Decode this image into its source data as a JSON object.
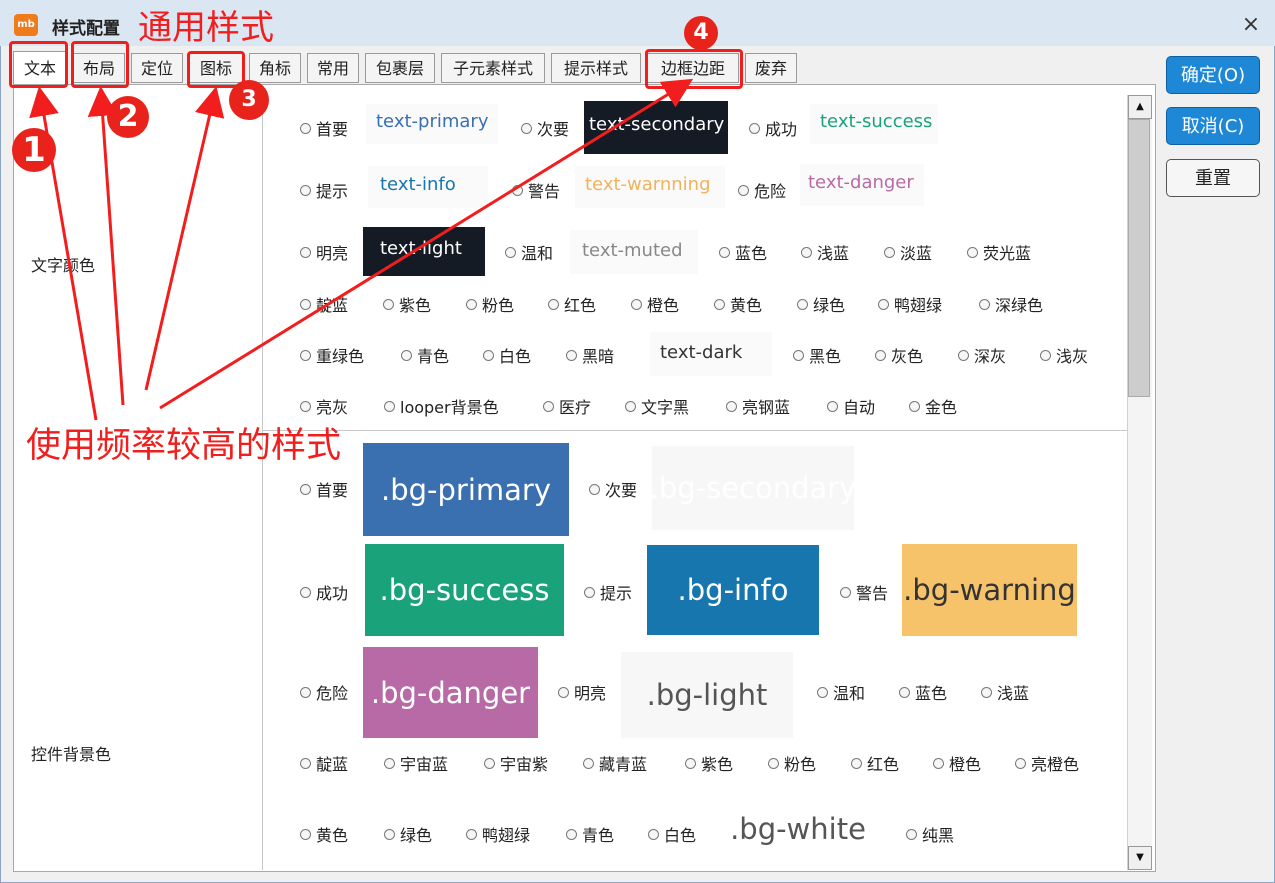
{
  "window": {
    "title": "样式配置",
    "app_icon_text": "mb",
    "close_glyph": "×"
  },
  "tabs": [
    "文本",
    "布局",
    "定位",
    "图标",
    "角标",
    "常用",
    "包裹层",
    "子元素样式",
    "提示样式",
    "边框边距",
    "废弃"
  ],
  "active_tab": "文本",
  "buttons": {
    "ok": "确定(O)",
    "cancel": "取消(C)",
    "reset": "重置"
  },
  "text_color": {
    "group_label": "文字颜色",
    "rows": [
      [
        {
          "label": "首要",
          "sample": "text-primary"
        },
        {
          "label": "次要",
          "sample": "text-secondary"
        },
        {
          "label": "成功",
          "sample": "text-success"
        }
      ],
      [
        {
          "label": "提示",
          "sample": "text-info"
        },
        {
          "label": "警告",
          "sample": "text-warnning"
        },
        {
          "label": "危险",
          "sample": "text-danger"
        }
      ],
      [
        {
          "label": "明亮",
          "sample": "text-light"
        },
        {
          "label": "温和",
          "sample": "text-muted"
        },
        {
          "label": "蓝色"
        },
        {
          "label": "浅蓝"
        },
        {
          "label": "淡蓝"
        },
        {
          "label": "荧光蓝"
        }
      ],
      [
        {
          "label": "靛蓝"
        },
        {
          "label": "紫色"
        },
        {
          "label": "粉色"
        },
        {
          "label": "红色"
        },
        {
          "label": "橙色"
        },
        {
          "label": "黄色"
        },
        {
          "label": "绿色"
        },
        {
          "label": "鸭翅绿"
        },
        {
          "label": "深绿色"
        }
      ],
      [
        {
          "label": "重绿色"
        },
        {
          "label": "青色"
        },
        {
          "label": "白色"
        },
        {
          "label": "黑暗",
          "sample": "text-dark"
        },
        {
          "label": "黑色"
        },
        {
          "label": "灰色"
        },
        {
          "label": "深灰"
        },
        {
          "label": "浅灰"
        }
      ],
      [
        {
          "label": "亮灰"
        },
        {
          "label": "looper背景色"
        },
        {
          "label": "医疗"
        },
        {
          "label": "文字黑"
        },
        {
          "label": "亮钢蓝"
        },
        {
          "label": "自动"
        },
        {
          "label": "金色"
        }
      ]
    ]
  },
  "bg_color": {
    "group_label": "控件背景色",
    "rows": [
      [
        {
          "label": "首要",
          "sample": ".bg-primary"
        },
        {
          "label": "次要",
          "sample": ".bg-secondary"
        }
      ],
      [
        {
          "label": "成功",
          "sample": ".bg-success"
        },
        {
          "label": "提示",
          "sample": ".bg-info"
        },
        {
          "label": "警告",
          "sample": ".bg-warning"
        }
      ],
      [
        {
          "label": "危险",
          "sample": ".bg-danger"
        },
        {
          "label": "明亮",
          "sample": ".bg-light"
        },
        {
          "label": "温和"
        },
        {
          "label": "蓝色"
        },
        {
          "label": "浅蓝"
        }
      ],
      [
        {
          "label": "靛蓝"
        },
        {
          "label": "宇宙蓝"
        },
        {
          "label": "宇宙紫"
        },
        {
          "label": "藏青蓝"
        },
        {
          "label": "紫色"
        },
        {
          "label": "粉色"
        },
        {
          "label": "红色"
        },
        {
          "label": "橙色"
        },
        {
          "label": "亮橙色"
        }
      ],
      [
        {
          "label": "黄色"
        },
        {
          "label": "绿色"
        },
        {
          "label": "鸭翅绿"
        },
        {
          "label": "青色"
        },
        {
          "label": "白色",
          "sample": ".bg-white"
        },
        {
          "label": "纯黑"
        }
      ]
    ]
  },
  "colors": {
    "primary": "#3a6fb0",
    "secondary_bg": "#1a212b",
    "success": "#1aa37a",
    "info": "#1676ad",
    "warning": "#f6c36b",
    "danger": "#b86aa6",
    "annotation_red": "#f21d1d"
  },
  "annotations": {
    "header": "通用样式",
    "footer": "使用频率较高的样式",
    "numbers": [
      "1",
      "2",
      "3",
      "4"
    ]
  },
  "icons": [
    "app-logo-icon",
    "close-icon",
    "scroll-up-icon",
    "scroll-down-icon",
    "radio-icon"
  ]
}
